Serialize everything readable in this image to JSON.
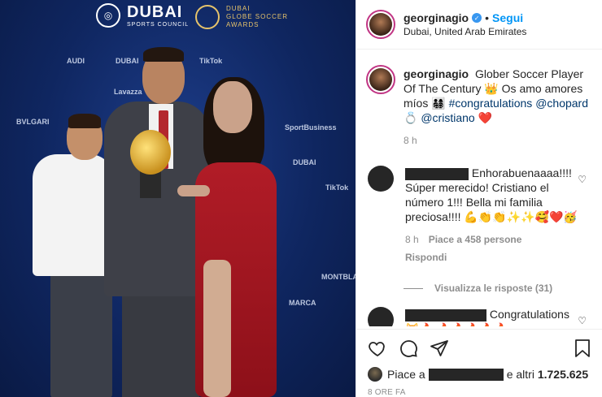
{
  "photo": {
    "dubai_big": "DUBAI",
    "dubai_small": "SPORTS COUNCIL",
    "gs_line1": "DUBAI",
    "gs_line2": "GLOBE SOCCER",
    "gs_line3": "AWARDS",
    "backdrop_logos": [
      "TikTok",
      "AUDI",
      "DUBAI",
      "Lavazza",
      "BVLGARI",
      "DUBAI",
      "SportBusiness",
      "MARCA",
      "TikTok",
      "MONTBLANC"
    ]
  },
  "header": {
    "username": "georginagio",
    "follow_label": "Segui",
    "separator": "•",
    "location": "Dubai, United Arab Emirates"
  },
  "caption": {
    "username": "georginagio",
    "text_before": "Glober Soccer Player Of The Century 👑 Os amo amores míos 👨‍👩‍👧‍👦",
    "hashtag": "#congratulations",
    "mention1": "@chopard",
    "ring_emoji": "💍",
    "mention2": "@cristiano",
    "end_emoji": "❤️",
    "time": "8 h"
  },
  "comments": [
    {
      "text": "Enhorabuenaaaa!!!! Súper merecido! Cristiano el número 1!!! Bella mi familia preciosa!!!! 💪👏👏✨✨🥰❤️🥳",
      "time": "8 h",
      "likes": "Piace a 458 persone",
      "reply_label": "Rispondi",
      "view_replies": "Visualizza le risposte (31)"
    },
    {
      "text": "Congratulations 😻🔥 🔥🔥🔥🔥🔥"
    }
  ],
  "likes": {
    "prefix": "Piace a",
    "suffix": "e altri",
    "count": "1.725.625"
  },
  "post_time": "8 ORE FA"
}
